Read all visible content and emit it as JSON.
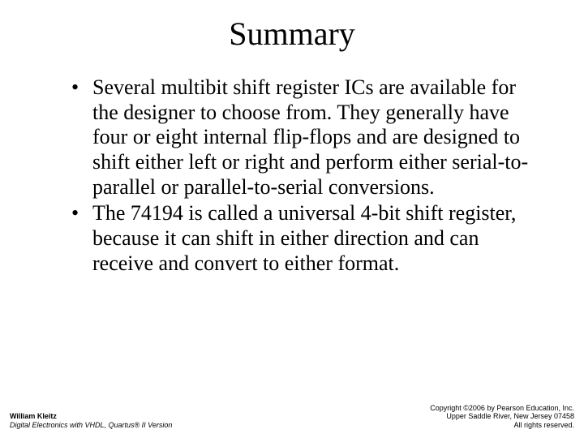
{
  "title": "Summary",
  "bullets": [
    "Several multibit shift register ICs are available for the designer to choose from. They generally have four or eight internal flip-flops and are designed to shift either left or right and perform either serial-to-parallel or parallel-to-serial conversions.",
    "The 74194 is called a universal 4-bit shift register, because it can shift in either direction and can receive and convert to either format."
  ],
  "footer_left": {
    "author": "William Kleitz",
    "book": "Digital Electronics with VHDL, Quartus® II Version"
  },
  "footer_right": {
    "line1": "Copyright ©2006 by Pearson Education, Inc.",
    "line2": "Upper Saddle River, New Jersey 07458",
    "line3": "All rights reserved."
  }
}
